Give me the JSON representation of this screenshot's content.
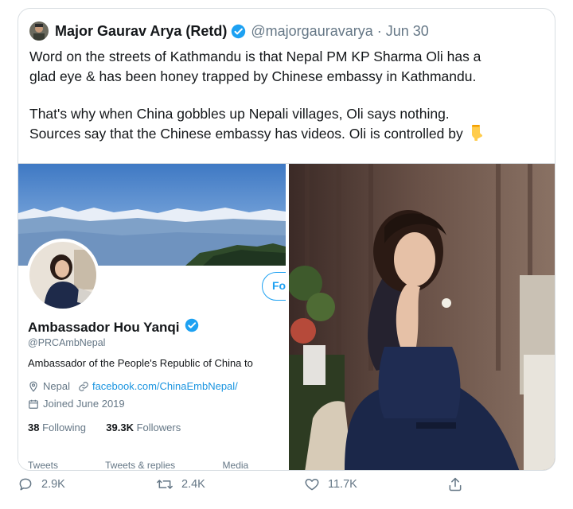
{
  "tweet": {
    "author_name": "Major Gaurav Arya (Retd)",
    "handle": "@majorgauravarya",
    "separator": "·",
    "date": "Jun 30",
    "lines": [
      "Word on the streets of Kathmandu is that Nepal PM KP Sharma Oli has a",
      "glad eye & has been honey trapped by Chinese embassy in Kathmandu.",
      "That's why when China gobbles up Nepali villages, Oli says nothing.",
      "Sources say that the Chinese embassy has videos. Oli is controlled by"
    ],
    "emoji": "👇"
  },
  "embedded_profile": {
    "name": "Ambassador Hou Yanqi",
    "handle": "@PRCAmbNepal",
    "bio": "Ambassador of the People's Republic of China to",
    "location": "Nepal",
    "link": "facebook.com/ChinaEmbNepal/",
    "joined": "Joined June 2019",
    "following_count": "38",
    "following_label": "Following",
    "followers_count": "39.3K",
    "followers_label": "Followers",
    "follow_button": "Fo",
    "tabs": [
      "Tweets",
      "Tweets & replies",
      "Media"
    ]
  },
  "actions": {
    "replies": "2.9K",
    "retweets": "2.4K",
    "likes": "11.7K"
  },
  "colors": {
    "accent": "#1da1f2",
    "text": "#14171a",
    "secondary": "#657786",
    "border": "#d9dee2"
  },
  "icons": [
    "verified-badge-icon",
    "reply-icon",
    "retweet-icon",
    "like-icon",
    "share-icon",
    "location-icon",
    "link-icon",
    "calendar-icon",
    "point-down-emoji"
  ]
}
